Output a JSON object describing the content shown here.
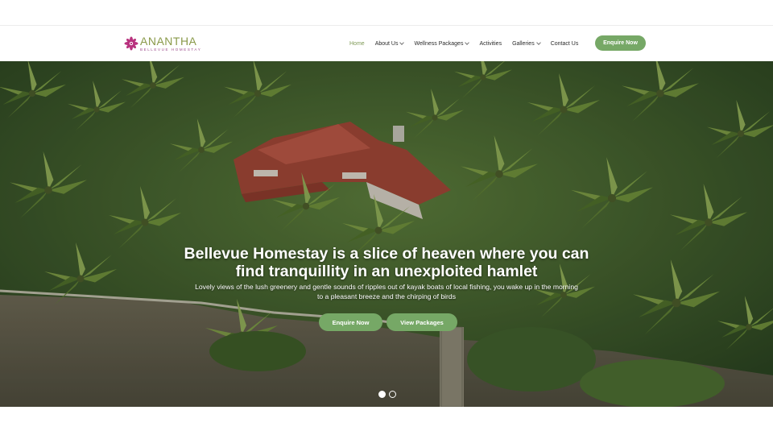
{
  "brand": {
    "name": "ANANTHA",
    "subtitle": "BELLEVUE HOMESTAY",
    "accent_color": "#76a866",
    "logo_color": "#b8327e"
  },
  "nav": {
    "items": [
      {
        "label": "Home",
        "active": true,
        "has_dropdown": false
      },
      {
        "label": "About Us",
        "active": false,
        "has_dropdown": true
      },
      {
        "label": "Wellness Packages",
        "active": false,
        "has_dropdown": true
      },
      {
        "label": "Activities",
        "active": false,
        "has_dropdown": false
      },
      {
        "label": "Galleries",
        "active": false,
        "has_dropdown": true
      },
      {
        "label": "Contact Us",
        "active": false,
        "has_dropdown": false
      }
    ],
    "cta_label": "Enquire Now"
  },
  "hero": {
    "headline_line1": "Bellevue Homestay is a slice of heaven where you can",
    "headline_line2": "find tranquillity in an unexploited hamlet",
    "subtext_line1": "Lovely views of the lush greenery and gentle sounds of ripples out of kayak boats of local fishing, you wake up in the morning",
    "subtext_line2": "to a pleasant breeze and the chirping of birds",
    "primary_button": "Enquire Now",
    "secondary_button": "View Packages",
    "slide_count": 2,
    "active_slide": 1
  }
}
